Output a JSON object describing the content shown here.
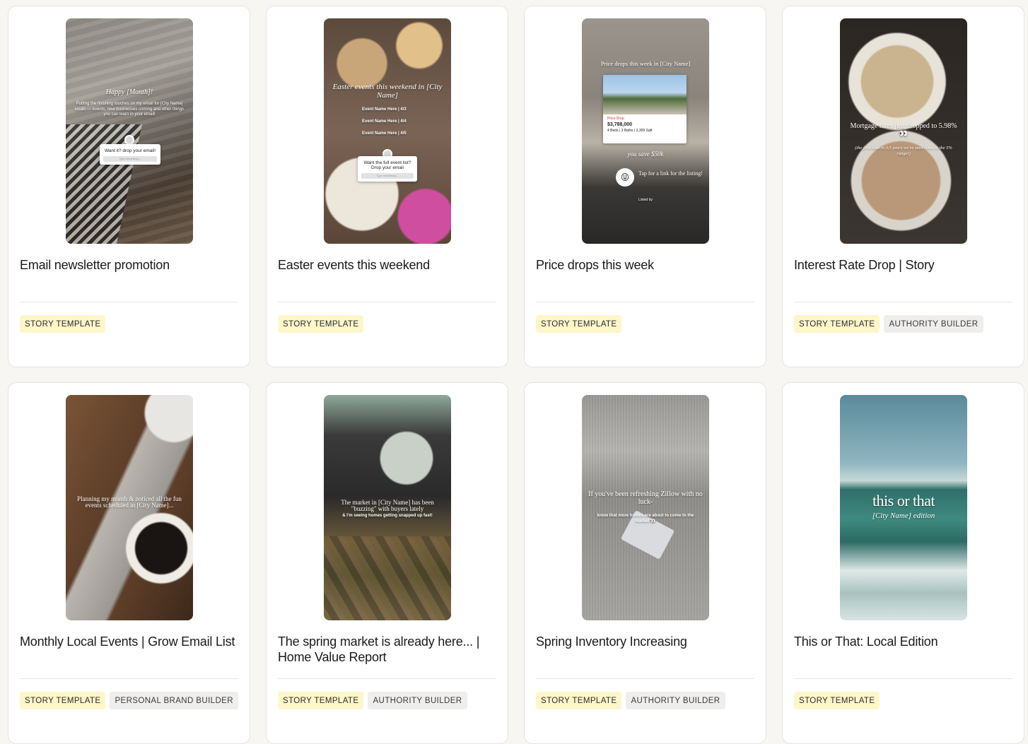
{
  "cards": [
    {
      "title": "Email newsletter promotion",
      "thumb": {
        "headline": "Happy [Month]!",
        "body": "Putting the finishing touches on my email for [City Name] locals — events, new businesses coming and other things you can learn in your email!",
        "popup": "Want it? drop your email!",
        "popup_field": "Type something..."
      },
      "tags": [
        {
          "label": "STORY TEMPLATE",
          "kind": "story"
        }
      ]
    },
    {
      "title": "Easter events this weekend",
      "thumb": {
        "headline": "Easter events this weekend in [City Name]",
        "lines": [
          "Event Name Here | 4/3",
          "Event Name Here | 4/4",
          "Event Name Here | 4/5"
        ],
        "popup": "Want the full event list? Drop your email",
        "popup_field": "Type something..."
      },
      "tags": [
        {
          "label": "STORY TEMPLATE",
          "kind": "story"
        }
      ]
    },
    {
      "title": "Price drops this week",
      "thumb": {
        "headline": "Price drops this week in [City Name]",
        "listing_badge": "Price Drop",
        "listing_price": "$3,788,000",
        "listing_details": "4 Beds | 3 Baths | 3,309 Sqft",
        "saved": "you save $50k",
        "cta": "Tap for a link for the listing!",
        "footer": "Listed by"
      },
      "tags": [
        {
          "label": "STORY TEMPLATE",
          "kind": "story"
        }
      ]
    },
    {
      "title": "Interest Rate Drop | Story",
      "thumb": {
        "headline": "Mortgage rates just dropped to 5.98% 👀",
        "body": "(the first time in 3.5 years we've seen rates in the 5% range!)"
      },
      "tags": [
        {
          "label": "STORY TEMPLATE",
          "kind": "story"
        },
        {
          "label": "AUTHORITY BUILDER",
          "kind": "other"
        }
      ]
    },
    {
      "title": "Monthly Local Events | Grow Email List",
      "thumb": {
        "headline": "Planning my month & noticed all the fun events scheduled in [City Name]..."
      },
      "tags": [
        {
          "label": "STORY TEMPLATE",
          "kind": "story"
        },
        {
          "label": "PERSONAL BRAND BUILDER",
          "kind": "other"
        }
      ]
    },
    {
      "title": "The spring market is already here... | Home Value Report",
      "thumb": {
        "headline": "The market in [City Name] has been \"buzzing\" with buyers lately",
        "body": "& I'm seeing homes getting snapped up fast!"
      },
      "tags": [
        {
          "label": "STORY TEMPLATE",
          "kind": "story"
        },
        {
          "label": "AUTHORITY BUILDER",
          "kind": "other"
        }
      ]
    },
    {
      "title": "Spring Inventory Increasing",
      "thumb": {
        "headline": "If you've been refreshing Zillow with no luck-",
        "body": "know that more homes are about to come to the market 👀"
      },
      "tags": [
        {
          "label": "STORY TEMPLATE",
          "kind": "story"
        },
        {
          "label": "AUTHORITY BUILDER",
          "kind": "other"
        }
      ]
    },
    {
      "title": "This or That: Local Edition",
      "thumb": {
        "headline": "this or that",
        "body": "[City Name] edition"
      },
      "tags": [
        {
          "label": "STORY TEMPLATE",
          "kind": "story"
        }
      ]
    }
  ],
  "colors": {
    "page_bg": "#f7f6f3",
    "card_bg": "#ffffff",
    "story_tag_bg": "#fdf6c9",
    "other_tag_bg": "#efeeec"
  }
}
